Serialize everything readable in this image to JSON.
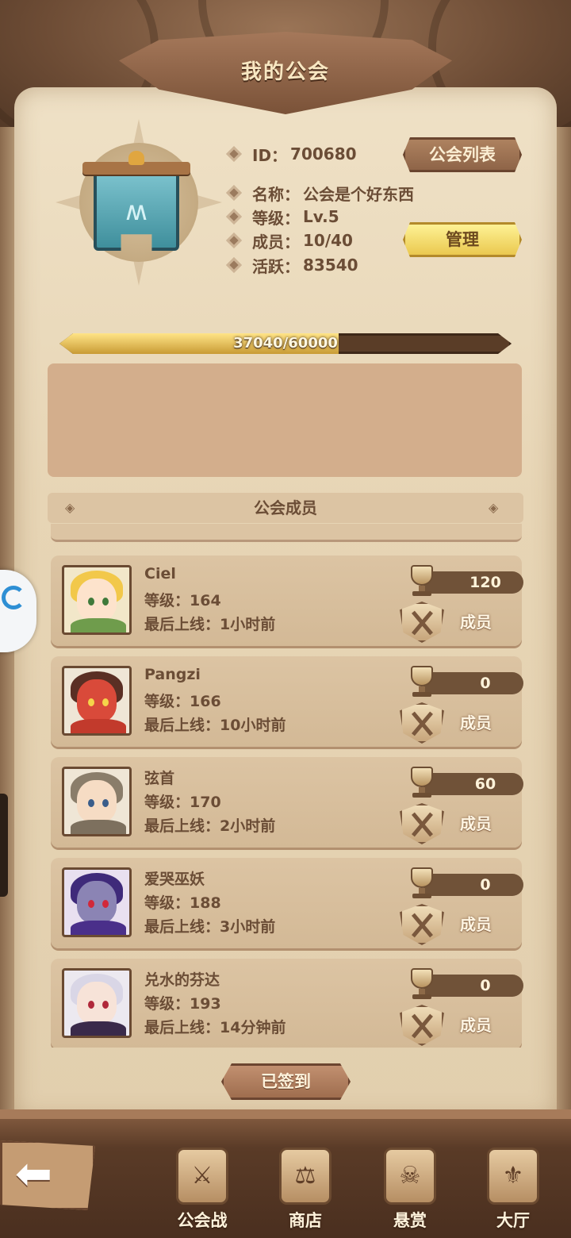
{
  "header": {
    "title": "我的公会"
  },
  "guild": {
    "id_label": "ID：",
    "id": "700680",
    "name_label": "名称：",
    "name": "公会是个好东西",
    "level_label": "等级：",
    "level": "Lv.5",
    "members_label": "成员：",
    "members": "10/40",
    "activity_label": "活跃：",
    "activity": "83540"
  },
  "buttons": {
    "guild_list": "公会列表",
    "manage": "管理",
    "signed_in": "已签到"
  },
  "progress": {
    "text": "37040/60000",
    "current": 37040,
    "max": 60000
  },
  "members_section": {
    "title": "公会成员"
  },
  "members": [
    {
      "name": "Ciel",
      "level": "等级：164",
      "last_online": "最后上线：1小时前",
      "score": "120",
      "role": "成员"
    },
    {
      "name": "Pangzi",
      "level": "等级：166",
      "last_online": "最后上线：10小时前",
      "score": "0",
      "role": "成员"
    },
    {
      "name": "弦首",
      "level": "等级：170",
      "last_online": "最后上线：2小时前",
      "score": "60",
      "role": "成员"
    },
    {
      "name": "爱哭巫妖",
      "level": "等级：188",
      "last_online": "最后上线：3小时前",
      "score": "0",
      "role": "成员"
    },
    {
      "name": "兑水的芬达",
      "level": "等级：193",
      "last_online": "最后上线：14分钟前",
      "score": "0",
      "role": "成员"
    }
  ],
  "bottom_nav": [
    {
      "label": "公会战",
      "icon": "helmet-icon"
    },
    {
      "label": "商店",
      "icon": "shop-icon"
    },
    {
      "label": "悬赏",
      "icon": "bounty-icon"
    },
    {
      "label": "大厅",
      "icon": "hall-icon"
    }
  ],
  "colors": {
    "panel": "#e7d5b5",
    "text": "#6b4d36",
    "gold": "#e9c54a",
    "dark_brown": "#5a3b27"
  }
}
